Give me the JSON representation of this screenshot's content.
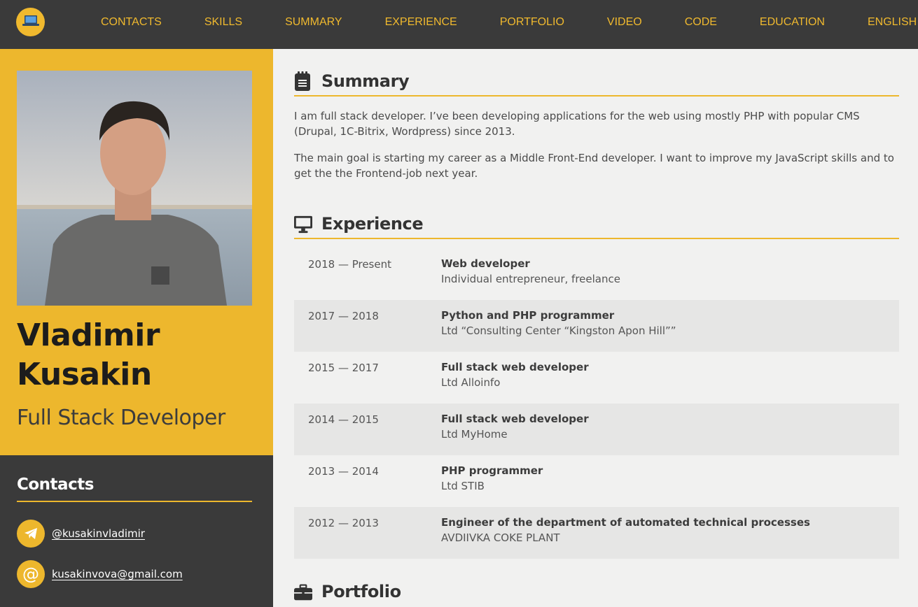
{
  "nav": {
    "logo_icon": "laptop-icon",
    "links": [
      "CONTACTS",
      "SKILLS",
      "SUMMARY",
      "EXPERIENCE",
      "PORTFOLIO",
      "VIDEO",
      "CODE",
      "EDUCATION",
      "ENGLISH"
    ]
  },
  "profile": {
    "first_name": "Vladimir",
    "last_name": "Kusakin",
    "role": "Full Stack Developer"
  },
  "contacts": {
    "title": "Contacts",
    "items": [
      {
        "icon": "telegram-icon",
        "text": "@kusakinvladimir"
      },
      {
        "icon": "at-icon",
        "text": "kusakinvova@gmail.com"
      }
    ]
  },
  "summary": {
    "title": "Summary",
    "icon": "notepad-icon",
    "paragraphs": [
      "I am full stack developer. I’ve been developing applications for the web using mostly PHP with popular CMS (Drupal, 1C-Bitrix, Wordpress) since 2013.",
      "The main goal is starting my career as a Middle Front-End developer. I want to improve my JavaScript skills and to get the the Frontend-job next year."
    ]
  },
  "experience": {
    "title": "Experience",
    "icon": "monitor-icon",
    "items": [
      {
        "period": "2018 — Present",
        "role": "Web developer",
        "company": "Individual entrepreneur, freelance"
      },
      {
        "period": "2017 — 2018",
        "role": "Python and PHP programmer",
        "company": "Ltd “Consulting Center “Kingston Apon Hill””"
      },
      {
        "period": "2015 — 2017",
        "role": "Full stack web developer",
        "company": "Ltd Alloinfo"
      },
      {
        "period": "2014 — 2015",
        "role": "Full stack web developer",
        "company": "Ltd MyHome"
      },
      {
        "period": "2013 — 2014",
        "role": "PHP programmer",
        "company": "Ltd STIB"
      },
      {
        "period": "2012 — 2013",
        "role": "Engineer of the department of automated technical processes",
        "company": "AVDIIVKA COKE PLANT"
      }
    ]
  },
  "portfolio": {
    "title": "Portfolio",
    "icon": "briefcase-icon"
  },
  "colors": {
    "accent": "#edb72d",
    "dark": "#3a3a3a",
    "background": "#f1f1f0",
    "row_alt": "#e6e6e5"
  }
}
